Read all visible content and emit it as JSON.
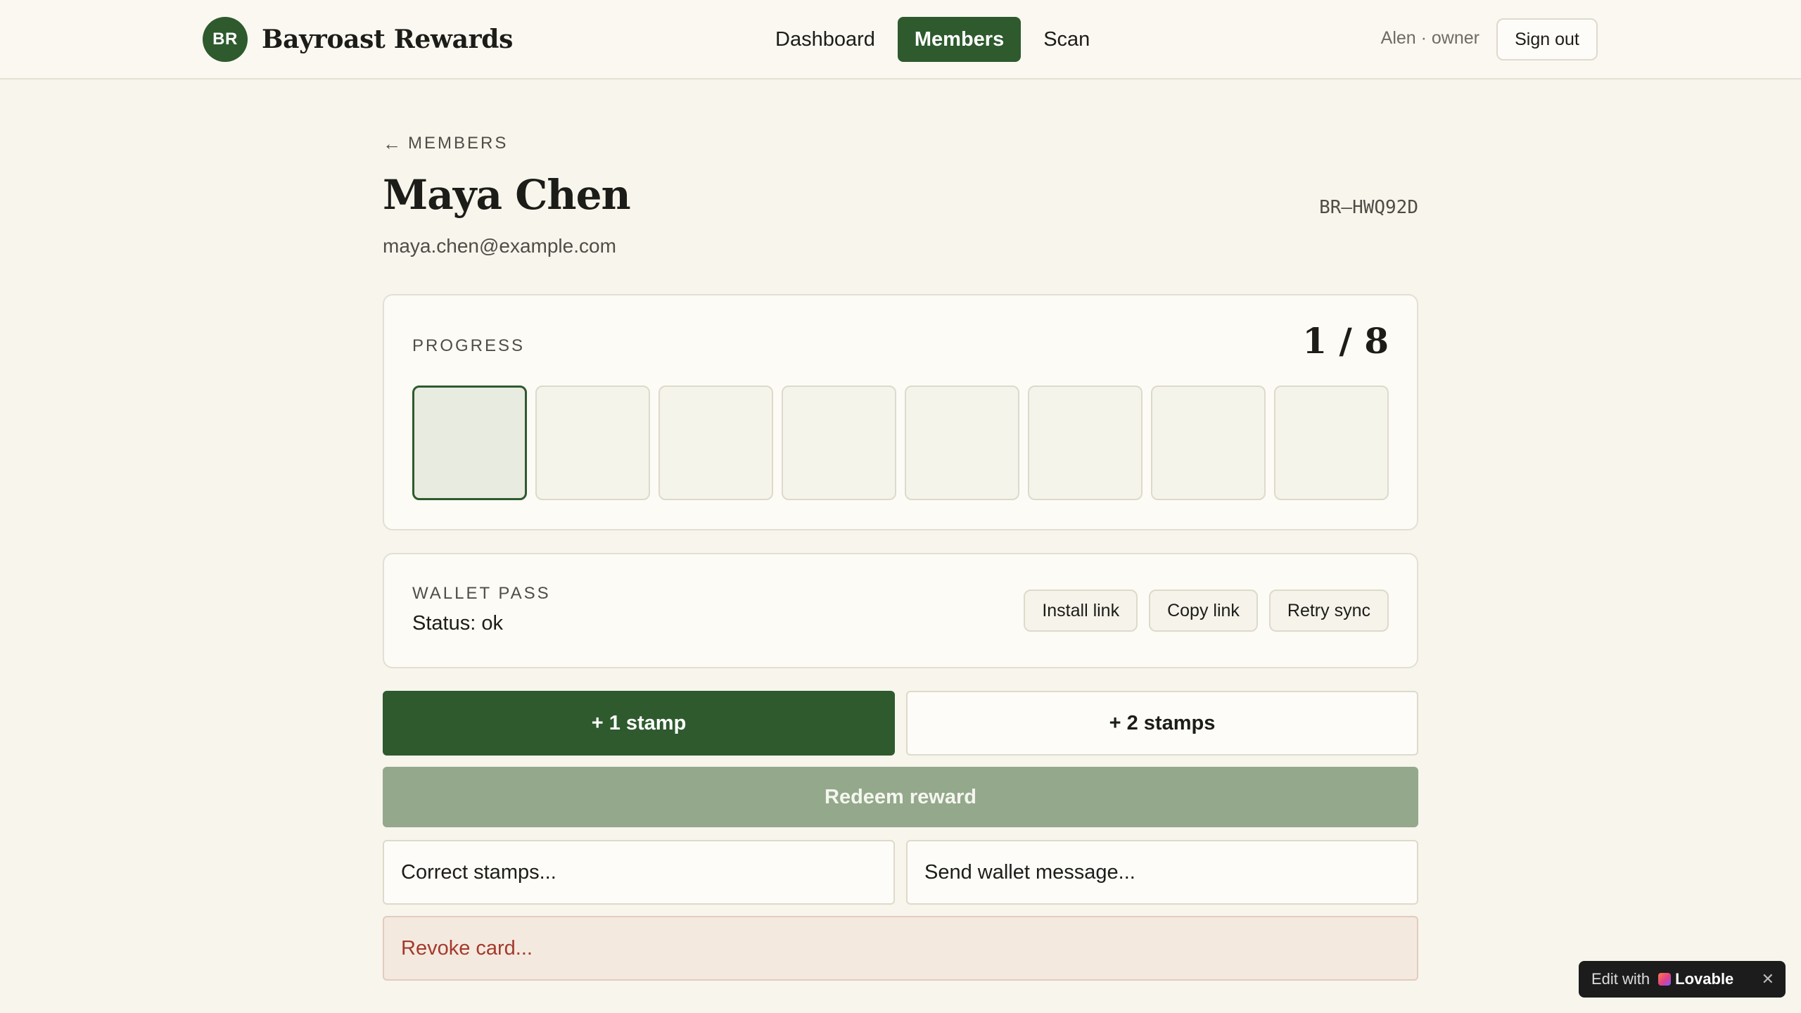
{
  "brand": {
    "logo_text": "BR",
    "name": "Bayroast Rewards"
  },
  "nav": {
    "items": [
      {
        "label": "Dashboard",
        "active": false
      },
      {
        "label": "Members",
        "active": true
      },
      {
        "label": "Scan",
        "active": false
      }
    ]
  },
  "user": {
    "info": "Alen · owner",
    "signout_label": "Sign out"
  },
  "back": {
    "arrow": "←",
    "label": "MEMBERS"
  },
  "member": {
    "name": "Maya Chen",
    "email": "maya.chen@example.com",
    "code": "BR–HWQ92D"
  },
  "progress": {
    "label": "PROGRESS",
    "count_text": "1 / 8",
    "filled": 1,
    "total": 8
  },
  "wallet": {
    "label": "WALLET PASS",
    "status": "Status: ok",
    "install_label": "Install link",
    "copy_label": "Copy link",
    "retry_label": "Retry sync"
  },
  "actions": {
    "add_one": "+ 1 stamp",
    "add_two": "+ 2 stamps",
    "redeem": "Redeem reward",
    "correct": "Correct stamps...",
    "send_message": "Send wallet message...",
    "revoke": "Revoke card..."
  },
  "badge": {
    "edit_text": "Edit with",
    "brand": "Lovable",
    "close": "✕"
  },
  "colors": {
    "primary": "#2e5a2e",
    "redeem_disabled": "#94a88b",
    "danger_text": "#a23a2c",
    "danger_bg": "#f4e9df"
  },
  "icons": {
    "back": "arrow-left-icon",
    "close": "close-icon",
    "lovable": "lovable-logo-icon"
  }
}
